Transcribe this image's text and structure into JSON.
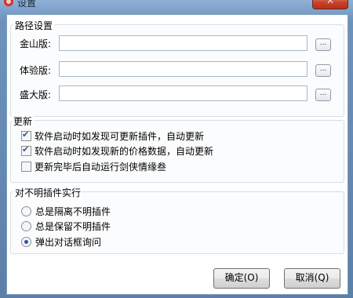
{
  "window": {
    "title": "设置",
    "close_glyph": "X"
  },
  "paths": {
    "title": "路径设置",
    "rows": [
      {
        "label": "金山版:",
        "value": "",
        "browse": "..."
      },
      {
        "label": "体验版:",
        "value": "",
        "browse": "..."
      },
      {
        "label": "盛大版:",
        "value": "",
        "browse": "..."
      }
    ]
  },
  "update": {
    "title": "更新",
    "options": [
      {
        "label": "软件启动时如发现可更新插件，自动更新",
        "checked": true
      },
      {
        "label": "软件启动时如发现新的价格数据，自动更新",
        "checked": true
      },
      {
        "label": "更新完毕后自动运行剑侠情缘叁",
        "checked": false
      }
    ]
  },
  "unknown_plugins": {
    "title": "对不明插件实行",
    "options": [
      {
        "label": "总是隔离不明插件",
        "selected": false
      },
      {
        "label": "总是保留不明插件",
        "selected": false
      },
      {
        "label": "弹出对话框询问",
        "selected": true
      }
    ]
  },
  "buttons": {
    "ok": "确定(O)",
    "cancel": "取消(Q)"
  },
  "colors": {
    "titlebar": "#6d93bd",
    "accent": "#2a5b9a",
    "close": "#c8432a"
  }
}
